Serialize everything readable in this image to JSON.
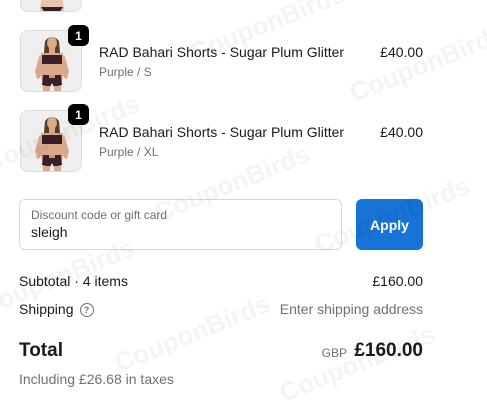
{
  "watermark": "CouponBirds",
  "items": [
    {
      "name": "RAD Bahari Shorts - Sugar Plum Glitter",
      "variant": "Purple / S",
      "price": "£40.00",
      "quantity": "1"
    },
    {
      "name": "RAD Bahari Shorts - Sugar Plum Glitter",
      "variant": "Purple / XL",
      "price": "£40.00",
      "quantity": "1"
    }
  ],
  "discount": {
    "label": "Discount code or gift card",
    "value": "sleigh",
    "apply_label": "Apply"
  },
  "summary": {
    "subtotal_label": "Subtotal · 4 items",
    "subtotal_value": "£160.00",
    "shipping_label": "Shipping",
    "shipping_value": "Enter shipping address",
    "total_label": "Total",
    "total_currency": "GBP",
    "total_value": "£160.00",
    "taxes_note": "Including £26.68 in taxes"
  },
  "colors": {
    "accent": "#1773d6",
    "badge": "#000000",
    "swimsuit": "#3a1e2a"
  },
  "icons": {
    "shipping_help": "question-circle-icon"
  }
}
